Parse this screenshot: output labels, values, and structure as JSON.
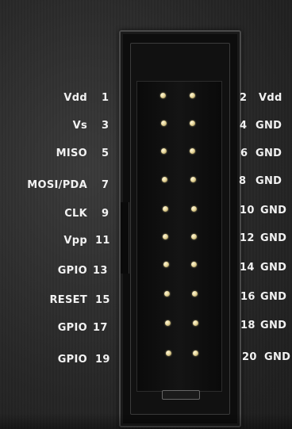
{
  "colors": {
    "board": "#262626",
    "header": "#0d0d0d",
    "pin": "#e8d89c",
    "text": "#f2f2f2"
  },
  "left_pins": [
    {
      "name": "Vdd",
      "number": "1"
    },
    {
      "name": "Vs",
      "number": "3"
    },
    {
      "name": "MISO",
      "number": "5"
    },
    {
      "name": "MOSI/PDA",
      "number": "7"
    },
    {
      "name": "CLK",
      "number": "9"
    },
    {
      "name": "Vpp",
      "number": "11"
    },
    {
      "name": "GPIO",
      "number": "13"
    },
    {
      "name": "RESET",
      "number": "15"
    },
    {
      "name": "GPIO",
      "number": "17"
    },
    {
      "name": "GPIO",
      "number": "19"
    }
  ],
  "right_pins": [
    {
      "number": "2",
      "name": "Vdd"
    },
    {
      "number": "4",
      "name": "GND"
    },
    {
      "number": "6",
      "name": "GND"
    },
    {
      "number": "8",
      "name": "GND"
    },
    {
      "number": "10",
      "name": "GND"
    },
    {
      "number": "12",
      "name": "GND"
    },
    {
      "number": "14",
      "name": "GND"
    },
    {
      "number": "16",
      "name": "GND"
    },
    {
      "number": "18",
      "name": "GND"
    },
    {
      "number": "20",
      "name": "GND"
    }
  ]
}
